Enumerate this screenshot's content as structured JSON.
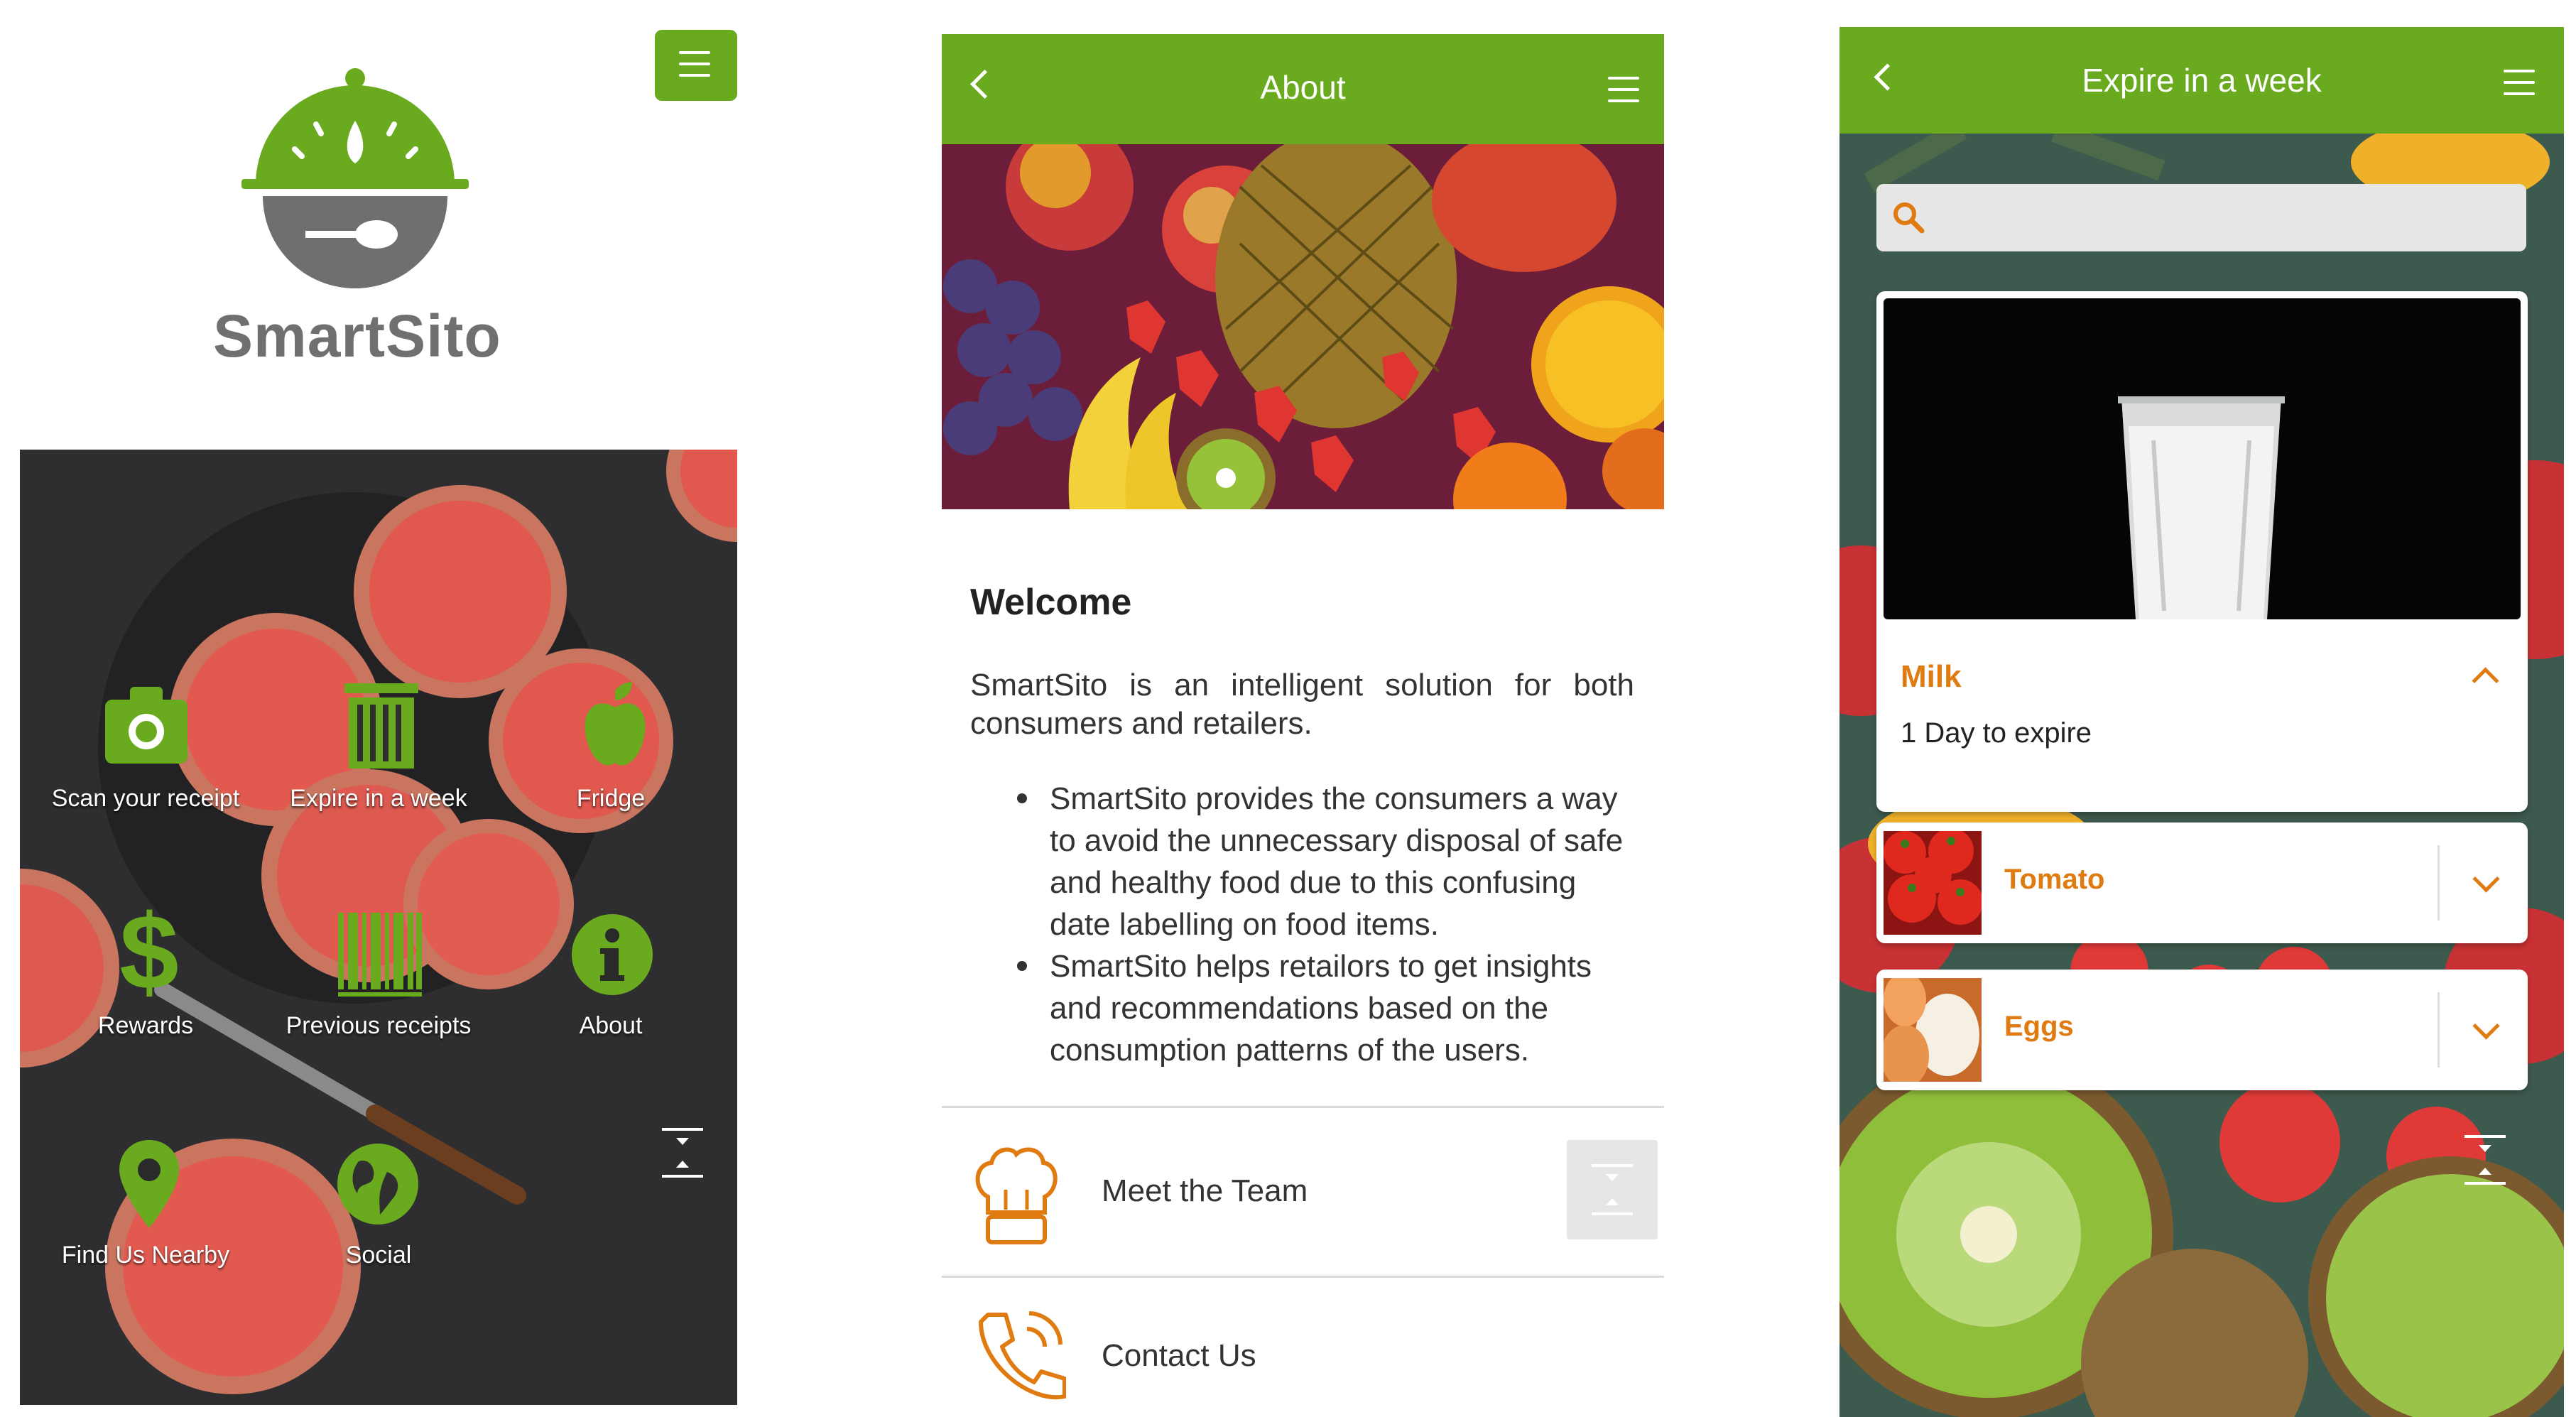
{
  "colors": {
    "green": "#6aaa1e",
    "orange": "#e07b12",
    "dark": "#2b2b2b"
  },
  "home": {
    "logo_text": "SmartSito",
    "menu_icon": "hamburger-icon",
    "tiles": [
      {
        "label": "Scan your receipt",
        "icon": "camera-icon"
      },
      {
        "label": "Expire in a week",
        "icon": "trash-icon"
      },
      {
        "label": "Fridge",
        "icon": "apple-icon"
      },
      {
        "label": "Rewards",
        "icon": "dollar-icon"
      },
      {
        "label": "Previous receipts",
        "icon": "barcode-icon"
      },
      {
        "label": "About",
        "icon": "info-icon"
      },
      {
        "label": "Find Us Nearby",
        "icon": "map-pin-icon"
      },
      {
        "label": "Social",
        "icon": "globe-icon"
      }
    ]
  },
  "about": {
    "title": "About",
    "heading": "Welcome",
    "intro": "SmartSito is an intelligent solution for both consumers and retailers.",
    "bullets": [
      "SmartSito provides the consumers a way to avoid the unnecessary disposal of safe and healthy food due to this confusing date labelling on food items.",
      "SmartSito helps retailors to get insights and recommendations based on the consumption patterns of the users."
    ],
    "list": [
      {
        "label": "Meet the Team",
        "icon": "chef-hat-icon"
      },
      {
        "label": "Contact Us",
        "icon": "phone-icon"
      }
    ]
  },
  "expire": {
    "title": "Expire in a week",
    "search_placeholder": "",
    "items": [
      {
        "name": "Milk",
        "detail": "1 Day to expire",
        "expanded": true
      },
      {
        "name": "Tomato",
        "expanded": false
      },
      {
        "name": "Eggs",
        "expanded": false
      }
    ]
  }
}
